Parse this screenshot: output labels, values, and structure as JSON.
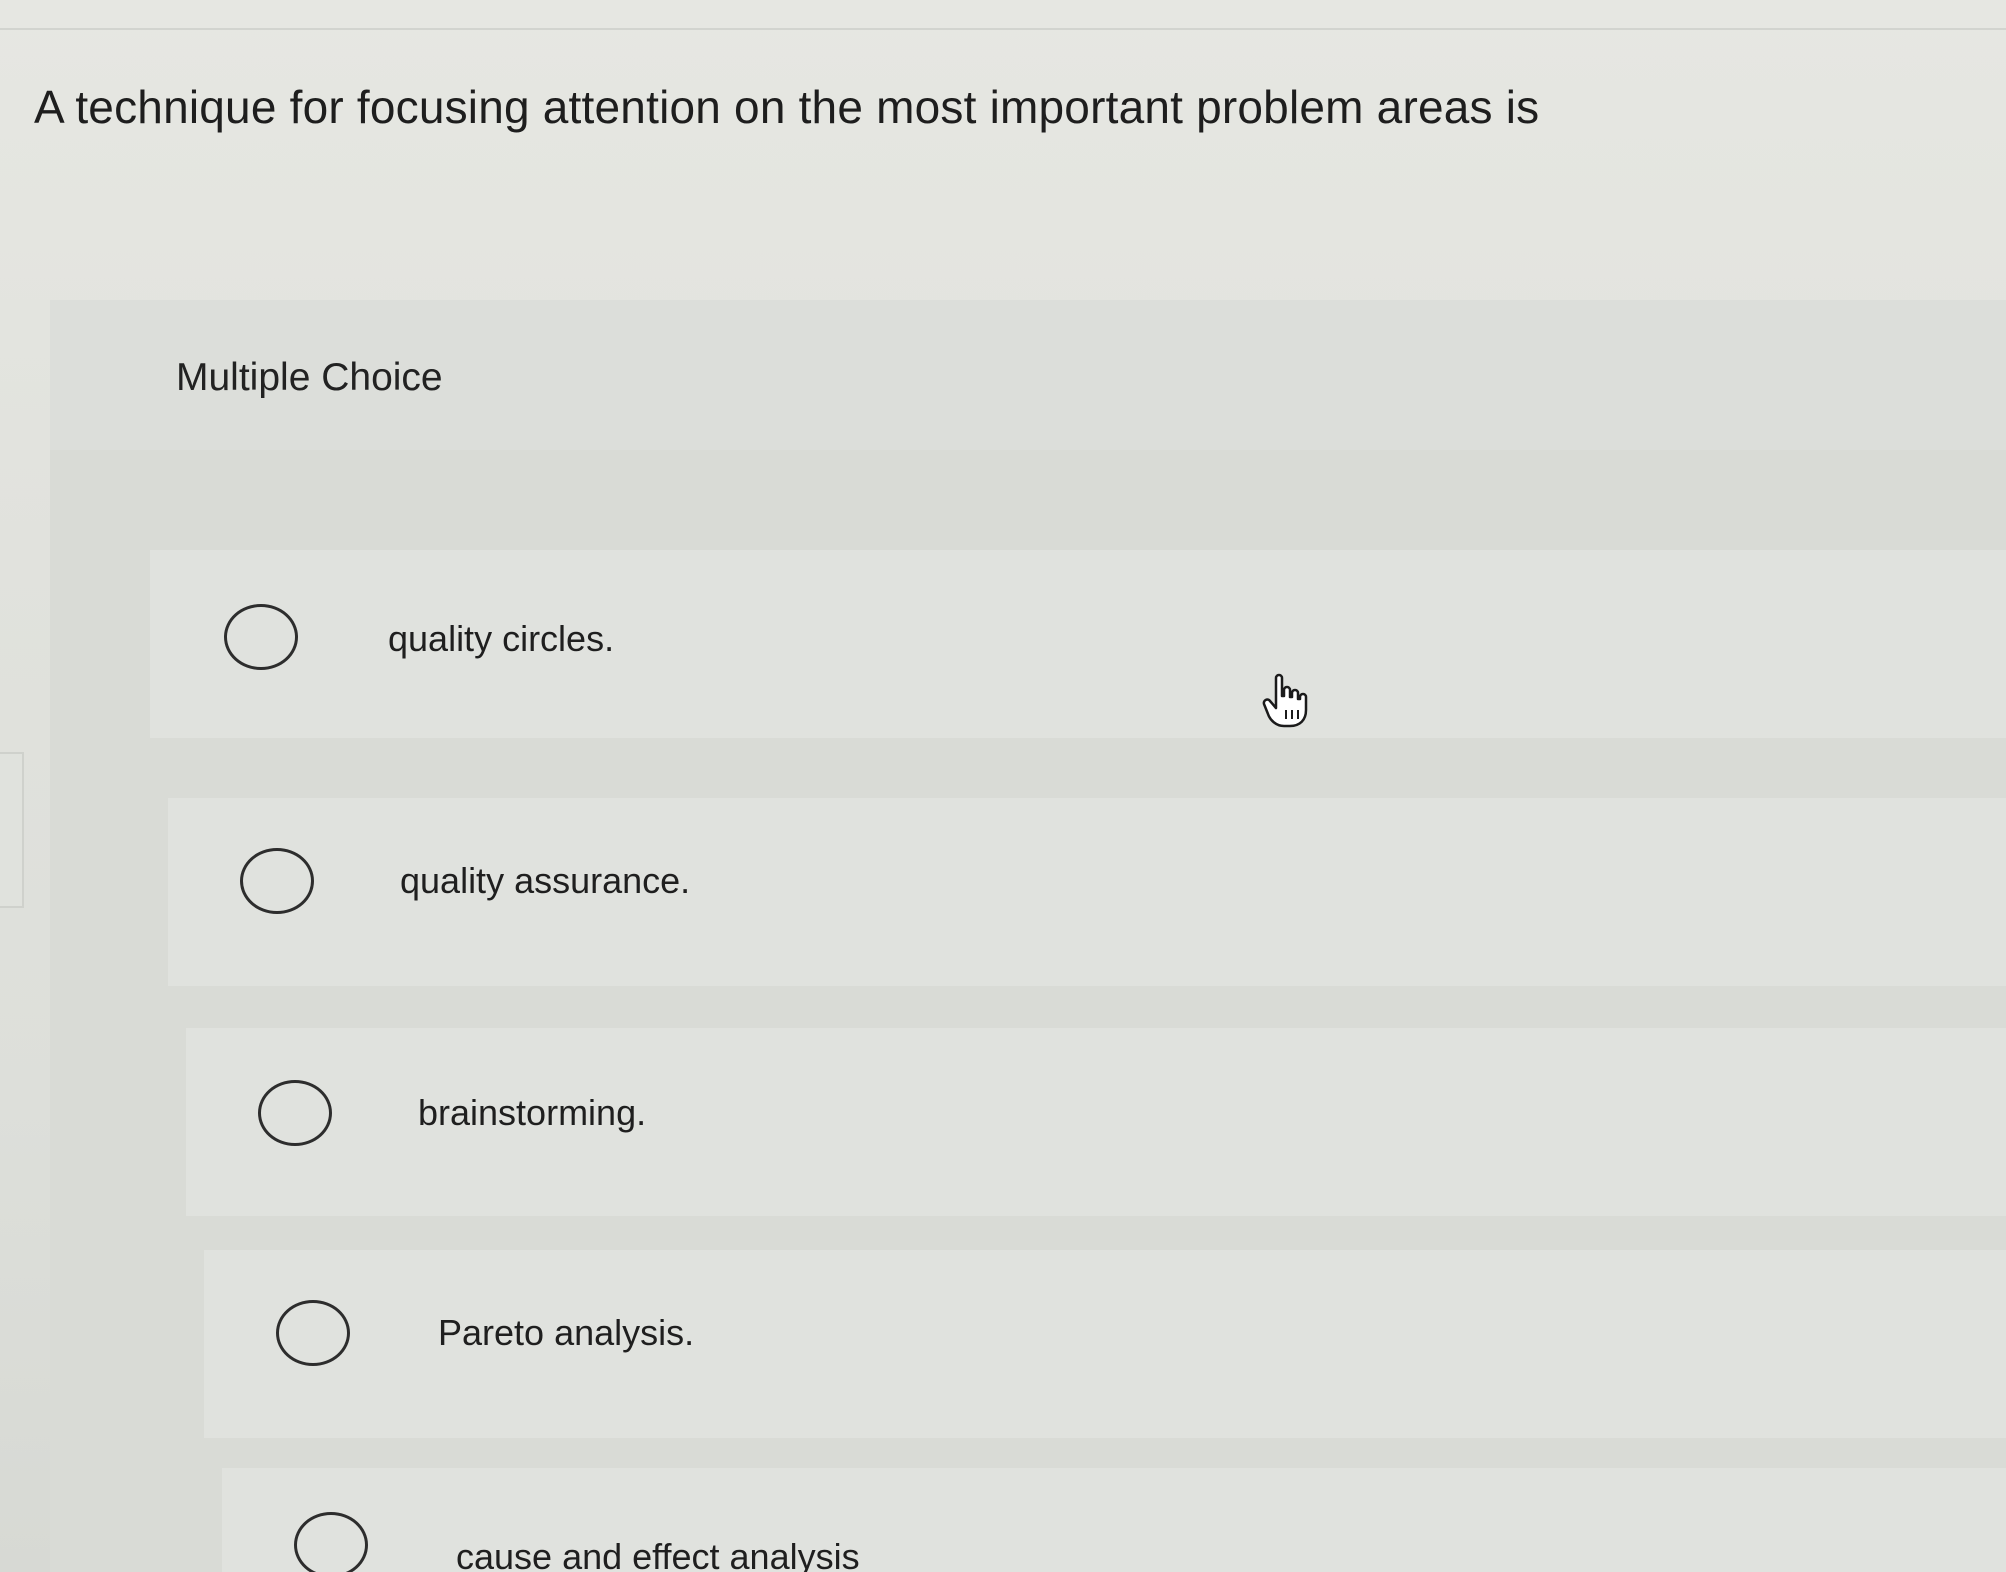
{
  "question": {
    "text": "A technique for focusing attention on the most important problem areas is"
  },
  "panel": {
    "title": "Multiple Choice"
  },
  "options": [
    {
      "label": "quality circles."
    },
    {
      "label": "quality assurance."
    },
    {
      "label": "brainstorming."
    },
    {
      "label": "Pareto analysis."
    },
    {
      "label": "cause and effect analysis"
    }
  ],
  "cursor": {
    "icon": "hand-pointer-icon"
  }
}
